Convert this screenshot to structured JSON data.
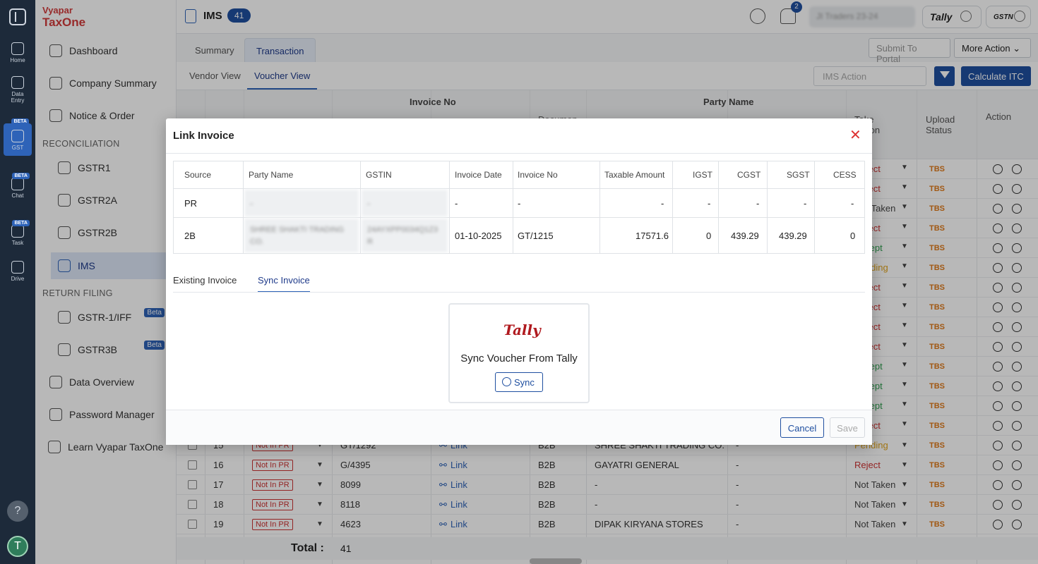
{
  "rail": {
    "home": "Home",
    "data_entry_1": "Data",
    "data_entry_2": "Entry",
    "gst": "GST",
    "chat": "Chat",
    "task": "Task",
    "drive": "Drive",
    "beta": "BETA",
    "help": "?",
    "user_initial": "T"
  },
  "brand": {
    "line1": "Vyapar",
    "line2": "TaxOne"
  },
  "sidebar": {
    "dashboard": "Dashboard",
    "company_summary": "Company Summary",
    "notice": "Notice & Order",
    "reconciliation": "RECONCILIATION",
    "gstr1": "GSTR1",
    "gstr2a": "GSTR2A",
    "gstr2b": "GSTR2B",
    "ims": "IMS",
    "return_filing": "RETURN FILING",
    "gstr1iff": "GSTR-1/IFF",
    "gstr3b": "GSTR3B",
    "beta": "Beta",
    "data_overview": "Data Overview",
    "password_manager": "Password Manager",
    "learn": "Learn Vyapar TaxOne"
  },
  "header": {
    "title": "IMS",
    "count": "41",
    "bell_count": "2",
    "company": "JI Traders 23-24",
    "tally": "Tally",
    "gstn": "GSTN"
  },
  "tabs": {
    "summary": "Summary",
    "transaction": "Transaction",
    "submit": "Submit To Portal",
    "more": "More Action"
  },
  "subtabs": {
    "vendor": "Vendor View",
    "voucher": "Voucher View",
    "ims_action": "IMS Action",
    "calc": "Calculate ITC"
  },
  "table": {
    "headers": {
      "invoice_no": "Invoice No",
      "party_name": "Party Name",
      "document": "Documen",
      "take_action": "Take\nAction",
      "upload_status": "Upload Status",
      "action": "Action"
    },
    "right_rows": [
      {
        "action": "Reject",
        "status": "TBS"
      },
      {
        "action": "Reject",
        "status": "TBS"
      },
      {
        "action": "Not Taken",
        "status": "TBS"
      },
      {
        "action": "Reject",
        "status": "TBS"
      },
      {
        "action": "Accept",
        "status": "TBS"
      },
      {
        "action": "Pending",
        "status": "TBS"
      },
      {
        "action": "Reject",
        "status": "TBS"
      },
      {
        "action": "Reject",
        "status": "TBS"
      },
      {
        "action": "Reject",
        "status": "TBS"
      },
      {
        "action": "Reject",
        "status": "TBS"
      },
      {
        "action": "Accept",
        "status": "TBS"
      },
      {
        "action": "Accept",
        "status": "TBS"
      },
      {
        "action": "Accept",
        "status": "TBS"
      },
      {
        "action": "Reject",
        "status": "TBS"
      }
    ],
    "rows": [
      {
        "no": "15",
        "pr": "Not In PR",
        "invoice": "GT/1292",
        "link": "Link",
        "doc": "B2B",
        "party": "SHREE SHAKTI TRADING CO.",
        "gstin": "-",
        "action": "Pending",
        "status": "TBS"
      },
      {
        "no": "16",
        "pr": "Not In PR",
        "invoice": "G/4395",
        "link": "Link",
        "doc": "B2B",
        "party": "GAYATRI GENERAL",
        "gstin": "-",
        "action": "Reject",
        "status": "TBS"
      },
      {
        "no": "17",
        "pr": "Not In PR",
        "invoice": "8099",
        "link": "Link",
        "doc": "B2B",
        "party": "-",
        "gstin": "-",
        "action": "Not Taken",
        "status": "TBS"
      },
      {
        "no": "18",
        "pr": "Not In PR",
        "invoice": "8118",
        "link": "Link",
        "doc": "B2B",
        "party": "-",
        "gstin": "-",
        "action": "Not Taken",
        "status": "TBS"
      },
      {
        "no": "19",
        "pr": "Not In PR",
        "invoice": "4623",
        "link": "Link",
        "doc": "B2B",
        "party": "DIPAK KIRYANA STORES",
        "gstin": "-",
        "action": "Not Taken",
        "status": "TBS"
      }
    ],
    "total_label": "Total :",
    "total_value": "41"
  },
  "modal": {
    "title": "Link Invoice",
    "close": "✕",
    "headers": [
      "Source",
      "Party Name",
      "GSTIN",
      "Invoice Date",
      "Invoice No",
      "Taxable Amount",
      "IGST",
      "CGST",
      "SGST",
      "CESS"
    ],
    "pr_row": {
      "source": "PR",
      "party": "-",
      "gstin": "-",
      "date": "-",
      "invoice": "-",
      "taxable": "-",
      "igst": "-",
      "cgst": "-",
      "sgst": "-",
      "cess": "-"
    },
    "b2_row": {
      "source": "2B",
      "party": "SHREE SHAKTI TRADING CO.",
      "gstin": "24AYXPP0034Q1Z3 R",
      "date": "01-10-2025",
      "invoice": "GT/1215",
      "taxable": "17571.6",
      "igst": "0",
      "cgst": "439.29",
      "sgst": "439.29",
      "cess": "0"
    },
    "tab_existing": "Existing Invoice",
    "tab_sync": "Sync Invoice",
    "tally_logo": "Tally",
    "card_title": "Sync Voucher From Tally",
    "sync": "Sync",
    "cancel": "Cancel",
    "save": "Save"
  },
  "colors": {
    "primary": "#1f4fa0",
    "reject": "#c33",
    "accept": "#2e9e4f",
    "pending": "#e0a21b",
    "tbs": "#e07b1b"
  }
}
